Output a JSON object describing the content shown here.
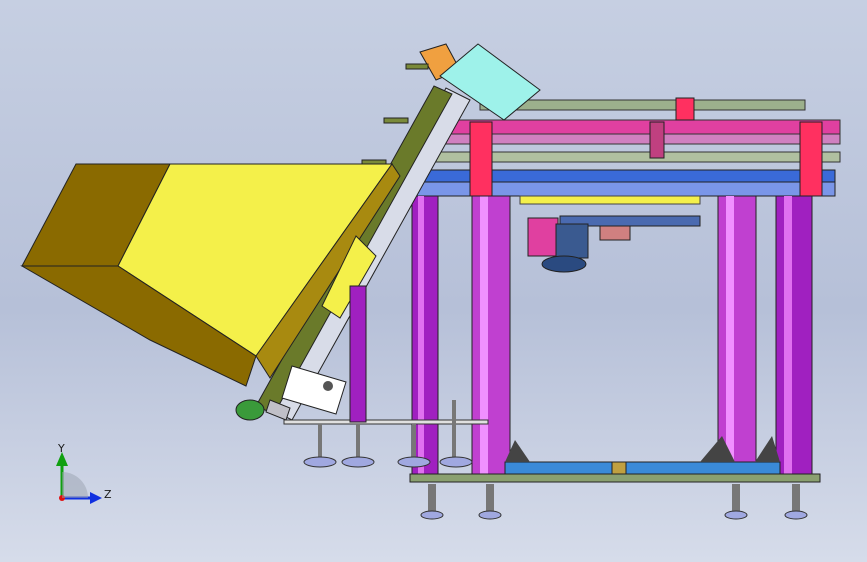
{
  "viewport": {
    "background_top": "#c6cfe2",
    "background_bottom": "#d6dcea"
  },
  "model": {
    "hopper_color": "#f4f04a",
    "hopper_dark_color": "#8a6a00",
    "frame_column_color": "#c040d0",
    "frame_beam_color": "#e040a0",
    "frame_accent_color": "#ff3060",
    "rail_color": "#3a6ad8",
    "conveyor_color": "#6a7a2a",
    "motor_cover_color": "#9ef2ea",
    "motor_body_color": "#3a6aa8",
    "foot_color": "#a0a8e0"
  },
  "triad": {
    "y_label": "Y",
    "z_label": "Z",
    "y_axis_color": "#10a010",
    "z_axis_color": "#1030e0",
    "origin_color": "#e01010"
  }
}
